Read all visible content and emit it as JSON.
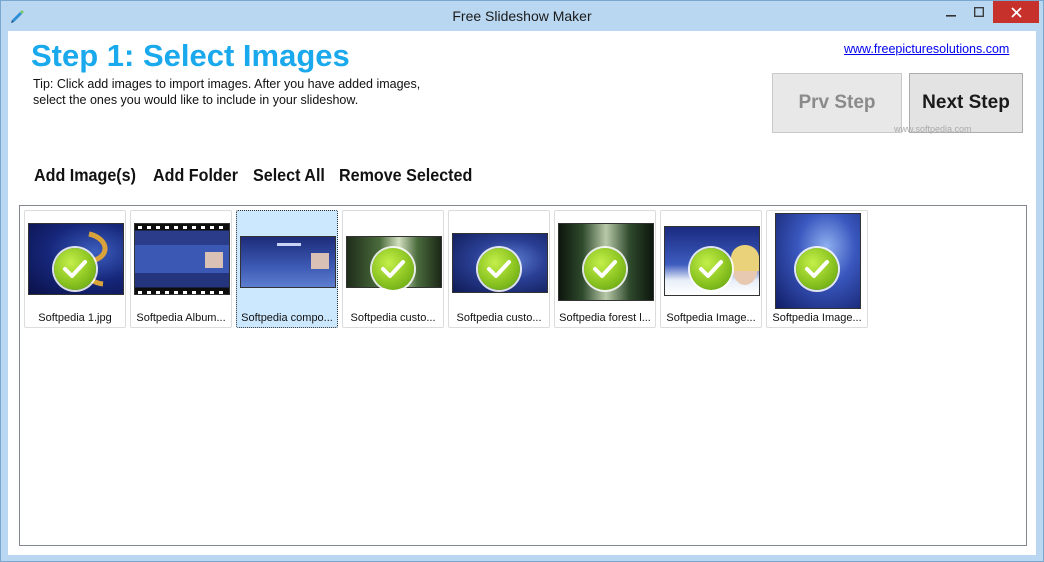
{
  "window": {
    "title": "Free Slideshow Maker"
  },
  "header": {
    "step_title": "Step 1: Select Images",
    "tip": "Tip: Click add images to import images. After you have added images, select the ones you would like to include in your slideshow.",
    "link": "www.freepicturesolutions.com",
    "prev_button": "Prv Step",
    "next_button": "Next Step",
    "watermark": "www.softpedia.com"
  },
  "toolbar": {
    "add_images": "Add Image(s)",
    "add_folder": "Add Folder",
    "select_all": "Select All",
    "remove_selected": "Remove Selected"
  },
  "thumbnails": [
    {
      "caption": "Softpedia 1.jpg",
      "checked": true
    },
    {
      "caption": "Softpedia Album...",
      "checked": false
    },
    {
      "caption": "Softpedia compo...",
      "checked": false,
      "selected": true
    },
    {
      "caption": "Softpedia custo...",
      "checked": true
    },
    {
      "caption": "Softpedia custo...",
      "checked": true
    },
    {
      "caption": "Softpedia forest l...",
      "checked": true
    },
    {
      "caption": "Softpedia Image...",
      "checked": true
    },
    {
      "caption": "Softpedia Image...",
      "checked": true
    }
  ],
  "colors": {
    "accent": "#1aa9ec",
    "close_button": "#c7312b",
    "check_green": "#8bc421"
  }
}
